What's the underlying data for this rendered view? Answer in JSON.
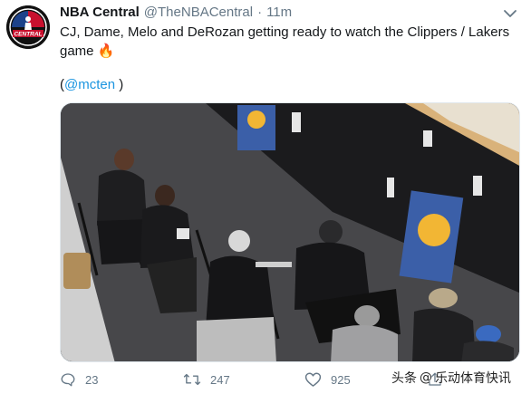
{
  "tweet": {
    "author_name": "NBA Central",
    "author_handle": "@TheNBACentral",
    "separator": "·",
    "timestamp": "11m",
    "text": "CJ, Dame, Melo and DeRozan getting ready to watch the Clippers / Lakers game",
    "text_emoji": "🔥",
    "mention_open": "(",
    "mention": "@mcten",
    "mention_close": " )",
    "avatar_logo_text": "CENTRAL",
    "media_description": "",
    "replies": "23",
    "retweets": "247",
    "likes": "925"
  },
  "watermark": {
    "prefix": "头条",
    "name": "乐动体育快讯"
  },
  "icons": {
    "reply": "reply-icon",
    "retweet": "retweet-icon",
    "like": "heart-icon",
    "share": "share-icon",
    "menu": "chevron-down-icon"
  },
  "colors": {
    "text": "#14171a",
    "secondary": "#657786",
    "link": "#1b95e0",
    "avatar_accent": "#c8102e"
  }
}
